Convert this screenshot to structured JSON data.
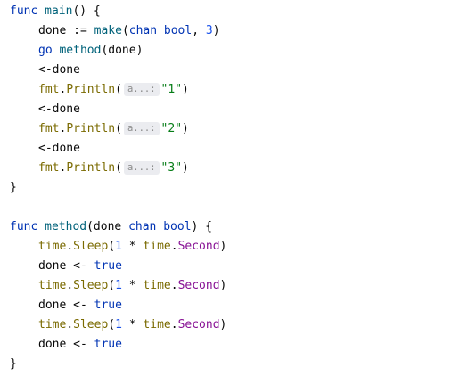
{
  "code": {
    "main": {
      "kw_func": "func",
      "name": "main",
      "sig_rest": "() {",
      "l1_a": "done := ",
      "l1_make": "make",
      "l1_b": "(",
      "l1_chan": "chan",
      "l1_c": " ",
      "l1_bool": "bool",
      "l1_d": ", ",
      "l1_num": "3",
      "l1_e": ")",
      "l2_go": "go",
      "l2_sp": " ",
      "l2_method": "method",
      "l2_rest": "(done)",
      "recv": "<-done",
      "fmt": "fmt",
      "dot": ".",
      "println": "Println",
      "open": "(",
      "hint": "a...:",
      "str1": "\"1\"",
      "str2": "\"2\"",
      "str3": "\"3\"",
      "close": ")",
      "end": "}"
    },
    "method": {
      "kw_func": "func",
      "name": "method",
      "sig_a": "(done ",
      "chan": "chan",
      "sp": " ",
      "bool": "bool",
      "sig_b": ") {",
      "time": "time",
      "dot": ".",
      "sleep": "Sleep",
      "open": "(",
      "one": "1",
      "mul": " * ",
      "second": "Second",
      "close": ")",
      "send": "done <- ",
      "true": "true",
      "end": "}"
    }
  },
  "colors": {
    "keyword": "#0033b3",
    "function": "#00627a",
    "package": "#7a6a00",
    "number": "#1750eb",
    "string": "#067d17",
    "field": "#871094"
  }
}
